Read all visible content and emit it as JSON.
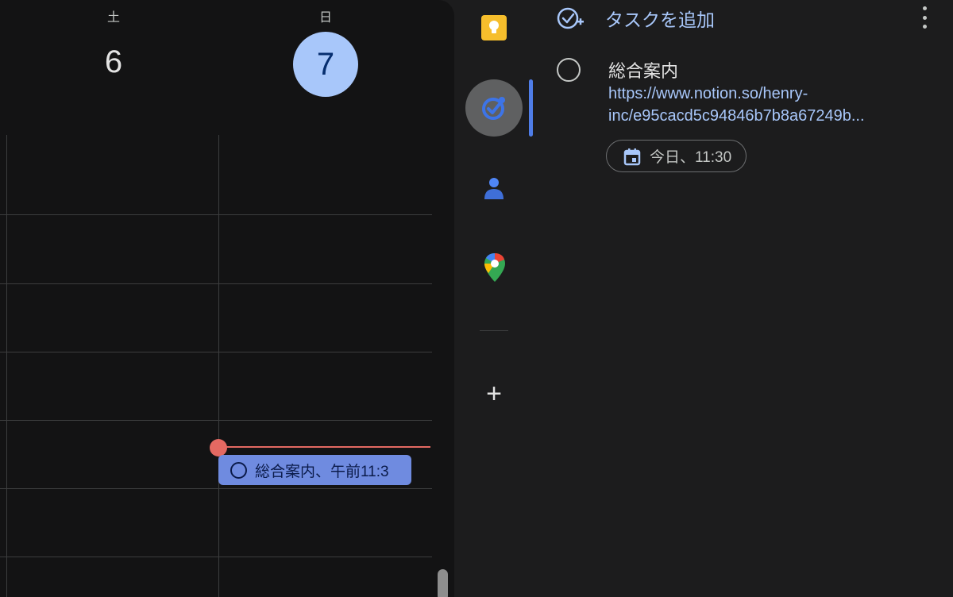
{
  "calendar": {
    "days": [
      {
        "dow": "土",
        "date": "6"
      },
      {
        "dow": "日",
        "date": "7"
      }
    ],
    "event": {
      "label": "総合案内、午前11:3"
    }
  },
  "rail": {
    "items": [
      {
        "name": "Keep",
        "icon": "keep-icon"
      },
      {
        "name": "Tasks",
        "icon": "tasks-icon",
        "active": true
      },
      {
        "name": "Contacts",
        "icon": "contacts-icon"
      },
      {
        "name": "Maps",
        "icon": "maps-icon"
      }
    ],
    "add_label": "+"
  },
  "tasks": {
    "add_task_label": "タスクを追加",
    "items": [
      {
        "title": "総合案内",
        "link_line1": "https://www.notion.so/henry-",
        "link_line2": "inc/e95cacd5c94846b7b8a67249b...",
        "due": "今日、11:30"
      }
    ]
  },
  "colors": {
    "accent": "#a8c7fa",
    "now_line": "#e46962",
    "event_bg": "#6f8be0",
    "background": "#131314"
  }
}
